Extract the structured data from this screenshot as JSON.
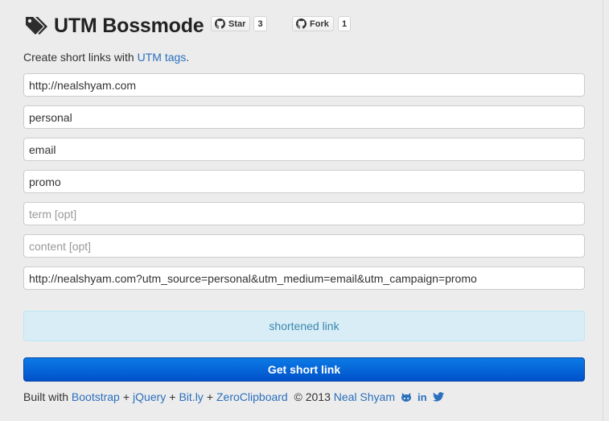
{
  "header": {
    "title": "UTM Bossmode",
    "icon": "tags-icon"
  },
  "github": {
    "star_label": "Star",
    "star_count": "3",
    "fork_label": "Fork",
    "fork_count": "1"
  },
  "intro": {
    "text": "Create short links with ",
    "link": "UTM tags",
    "end": "."
  },
  "form": {
    "url": "http://nealshyam.com",
    "source": "personal",
    "medium": "email",
    "campaign": "promo",
    "term_placeholder": "term [opt]",
    "content_placeholder": "content [opt]",
    "result": "http://nealshyam.com?utm_source=personal&utm_medium=email&utm_campaign=promo"
  },
  "shortened": {
    "label": "shortened link"
  },
  "action": {
    "button": "Get short link"
  },
  "footer": {
    "built_with": "Built with",
    "bootstrap": "Bootstrap",
    "jquery": "jQuery",
    "bitly": "Bit.ly",
    "zeroclipboard": "ZeroClipboard",
    "plus": "+",
    "copyright": "© 2013",
    "author": "Neal Shyam",
    "linkedin": "in",
    "social_icons": [
      "github-icon",
      "linkedin-icon",
      "twitter-icon"
    ]
  },
  "colors": {
    "link": "#2a6fbe",
    "alert_bg": "#d9edf7",
    "alert_text": "#3a87ad",
    "primary": "#0c6fe0"
  }
}
